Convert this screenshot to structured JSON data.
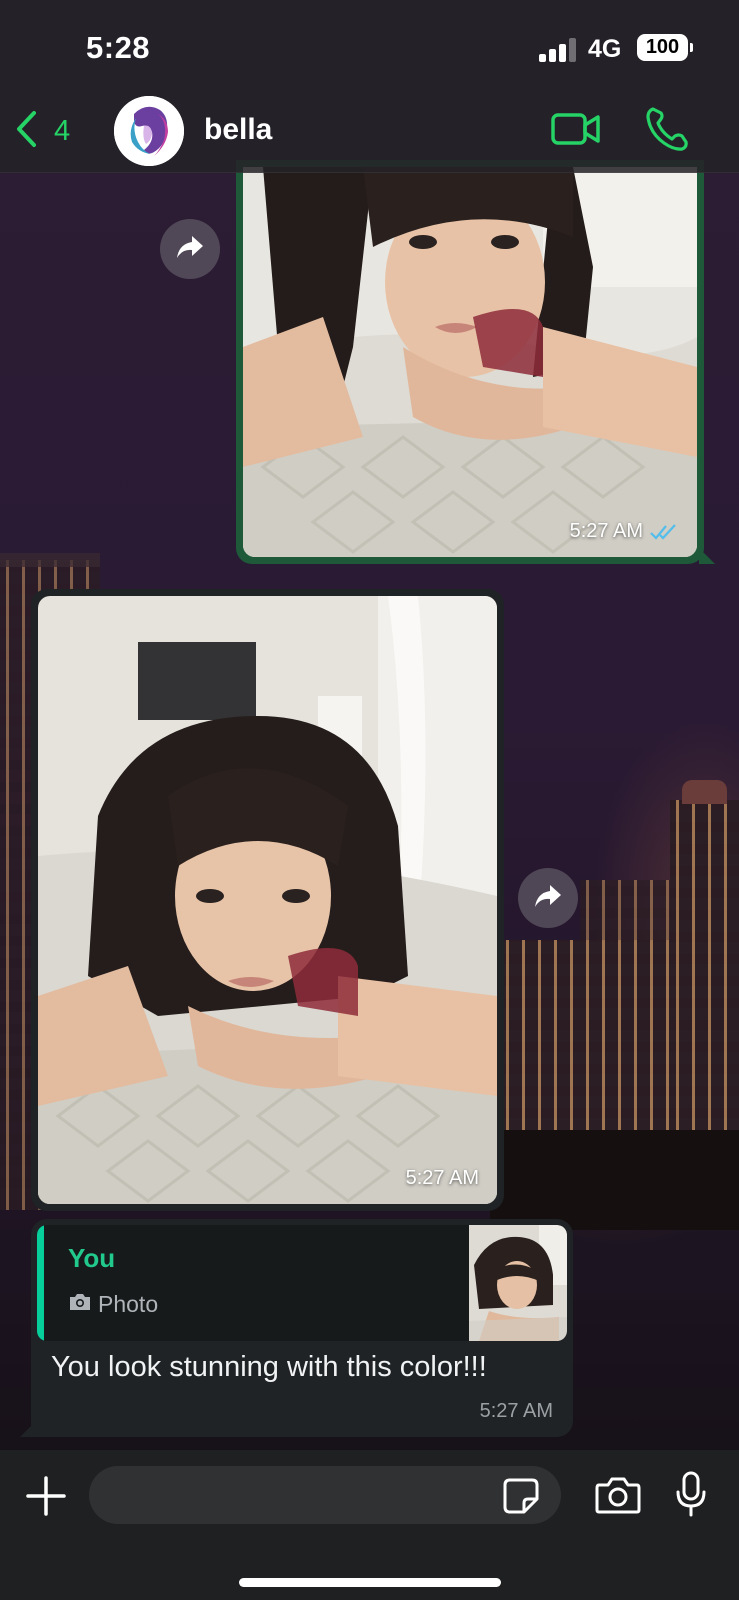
{
  "status_bar": {
    "time": "5:28",
    "network": "4G",
    "battery": "100",
    "signal_bars_active": 3,
    "signal_bars_total": 4
  },
  "header": {
    "back_count": "4",
    "contact_name": "bella",
    "accent_color": "#25d366",
    "icons": [
      "chevron-left-icon",
      "avatar",
      "video-call-icon",
      "phone-icon"
    ]
  },
  "messages": [
    {
      "direction": "outgoing",
      "type": "photo",
      "time": "5:27 AM",
      "status": "read",
      "status_icon": "double-check-icon"
    },
    {
      "direction": "incoming",
      "type": "photo",
      "time": "5:27 AM"
    },
    {
      "direction": "incoming",
      "type": "text",
      "quote": {
        "author": "You",
        "media_label": "Photo",
        "media_icon": "camera-icon"
      },
      "text": "You look stunning with this color!!!",
      "time": "5:27 AM"
    }
  ],
  "input": {
    "placeholder": "",
    "icons": [
      "plus-icon",
      "sticker-icon",
      "camera-icon",
      "microphone-icon"
    ]
  },
  "colors": {
    "outgoing_bubble_border": "#1e5a3a",
    "incoming_bubble": "#1f2325",
    "quote_accent": "#06cf9c",
    "read_ticks": "#53bdeb"
  }
}
